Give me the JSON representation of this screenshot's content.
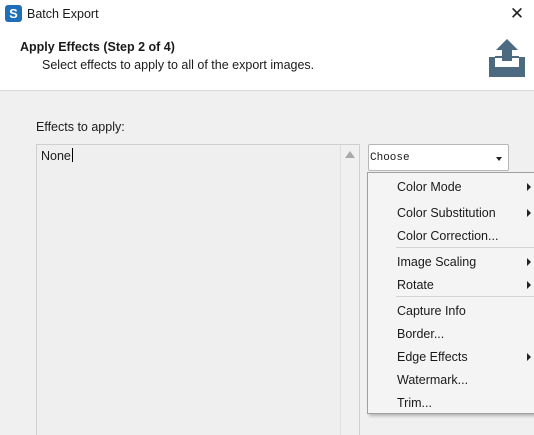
{
  "window": {
    "app_icon_letter": "S",
    "title": "Batch Export",
    "close_glyph": "✕"
  },
  "header": {
    "title": "Apply Effects (Step 2 of 4)",
    "description": "Select effects to apply to all of the export images.",
    "icon": "export-tray-upload-icon"
  },
  "effects": {
    "label": "Effects to apply:",
    "list_value": "None"
  },
  "choose": {
    "label": "Choose"
  },
  "menu": {
    "groups": [
      [
        {
          "label": "Color Mode",
          "submenu": true
        },
        {
          "label": "Color Substitution",
          "submenu": true
        },
        {
          "label": "Color Correction...",
          "submenu": false
        }
      ],
      [
        {
          "label": "Image Scaling",
          "submenu": true
        },
        {
          "label": "Rotate",
          "submenu": true
        }
      ],
      [
        {
          "label": "Capture Info",
          "submenu": false
        },
        {
          "label": "Border...",
          "submenu": false
        },
        {
          "label": "Edge Effects",
          "submenu": true
        },
        {
          "label": "Watermark...",
          "submenu": false
        },
        {
          "label": "Trim...",
          "submenu": false
        }
      ]
    ]
  },
  "colors": {
    "app_icon": "#1f6fb8",
    "export_icon": "#4d6b80",
    "background": "#f0f0f0"
  }
}
